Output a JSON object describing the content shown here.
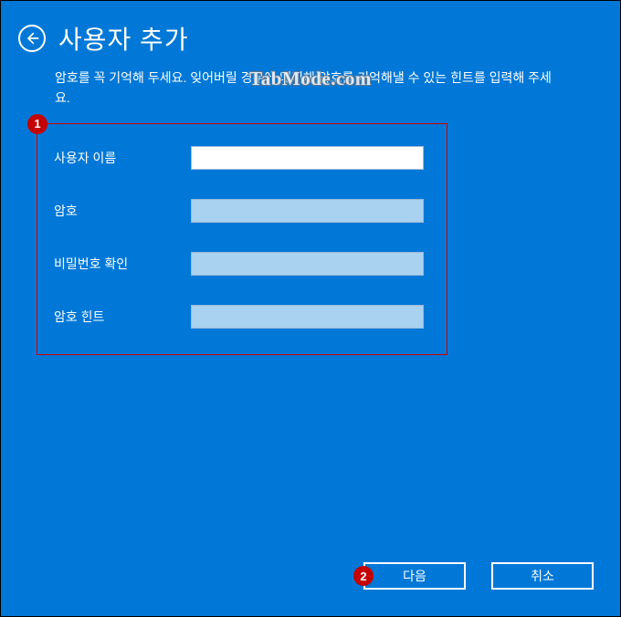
{
  "header": {
    "title": "사용자 추가"
  },
  "description": "암호를 꼭 기억해 두세요. 잊어버릴 경우에 대비해 암호를 기억해낼 수 있는 힌트를 입력해 주세요.",
  "watermark": "TabMode.com",
  "form": {
    "rows": [
      {
        "label": "사용자 이름",
        "value": "",
        "dimmed": false,
        "focused": true,
        "type": "text"
      },
      {
        "label": "암호",
        "value": "",
        "dimmed": true,
        "focused": false,
        "type": "password"
      },
      {
        "label": "비밀번호 확인",
        "value": "",
        "dimmed": true,
        "focused": false,
        "type": "password"
      },
      {
        "label": "암호 힌트",
        "value": "",
        "dimmed": true,
        "focused": false,
        "type": "text"
      }
    ]
  },
  "buttons": {
    "next": "다음",
    "cancel": "취소"
  },
  "annotations": {
    "one": "1",
    "two": "2"
  }
}
